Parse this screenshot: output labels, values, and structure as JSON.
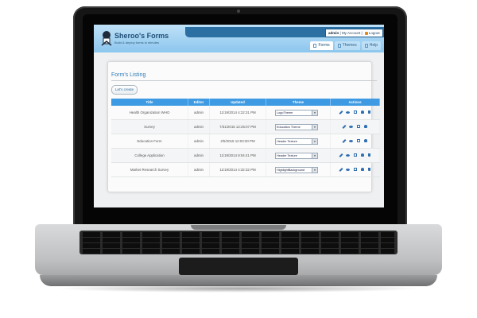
{
  "app": {
    "brand_title": "Sheroo's Forms",
    "brand_tagline": "Build & deploy forms in minutes"
  },
  "user_menu": {
    "username": "admin",
    "account_label": "My Account",
    "logout_label": "Logout"
  },
  "nav": {
    "tabs": [
      {
        "label": "Forms",
        "icon": "form-icon",
        "active": true
      },
      {
        "label": "Themes",
        "icon": "theme-icon",
        "active": false
      },
      {
        "label": "Help",
        "icon": "help-icon",
        "active": false
      }
    ]
  },
  "page": {
    "title": "Form's Listing",
    "create_button": "Let's create"
  },
  "table": {
    "columns": [
      "Title",
      "Editor",
      "Updated",
      "Theme",
      "Actions"
    ],
    "rows": [
      {
        "title": "Health Organization WHO",
        "editor": "admin",
        "updated": "11/19/2014 4:22:31 PM",
        "theme": "LogoTheme"
      },
      {
        "title": "Survey",
        "editor": "admin",
        "updated": "7/31/2015 12:25:07 PM",
        "theme": "Education Theme"
      },
      {
        "title": "Education Form",
        "editor": "admin",
        "updated": "2/5/2015 12:03:30 PM",
        "theme": "Header Texture"
      },
      {
        "title": "College Application",
        "editor": "admin",
        "updated": "11/19/2014 8:04:41 PM",
        "theme": "Header Texture"
      },
      {
        "title": "Market Research Survey",
        "editor": "admin",
        "updated": "11/19/2014 4:32:32 PM",
        "theme": "HighlightBackground"
      }
    ],
    "action_icons": [
      "edit-icon",
      "view-icon",
      "copy-icon",
      "user-icon",
      "delete-icon"
    ]
  },
  "colors": {
    "header_gradient_top": "#bfe1f7",
    "header_bar": "#2c6fa3",
    "table_header": "#3d9ae3",
    "accent_title": "#2f7bb5",
    "action_icon": "#2f6fb0"
  }
}
